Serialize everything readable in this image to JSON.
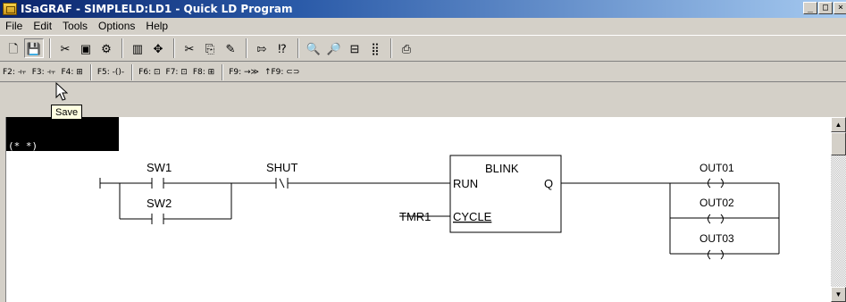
{
  "window": {
    "title": "ISaGRAF - SIMPLELD:LD1 - Quick LD Program",
    "controls": [
      "_",
      "□",
      "×"
    ]
  },
  "menu": [
    "File",
    "Edit",
    "Tools",
    "Options",
    "Help"
  ],
  "toolbar": {
    "icons": [
      {
        "name": "new-file-icon",
        "glyph": "🗋"
      },
      {
        "name": "save-icon",
        "glyph": "💾"
      },
      {
        "sep": true
      },
      {
        "name": "cut-tool-icon",
        "glyph": "✂"
      },
      {
        "name": "display-icon",
        "glyph": "▣"
      },
      {
        "name": "connect-icon",
        "glyph": "⚙"
      },
      {
        "sep": true
      },
      {
        "name": "book-icon",
        "glyph": "▥"
      },
      {
        "name": "move-icon",
        "glyph": "✥"
      },
      {
        "sep": true
      },
      {
        "name": "scissors-icon",
        "glyph": "✂"
      },
      {
        "name": "copy-icon",
        "glyph": "⎘"
      },
      {
        "name": "paste-icon",
        "glyph": "✎"
      },
      {
        "sep": true
      },
      {
        "name": "goto-icon",
        "glyph": "⇰"
      },
      {
        "name": "find-icon",
        "glyph": "⁉"
      },
      {
        "sep": true
      },
      {
        "name": "zoom-out-icon",
        "glyph": "🔍"
      },
      {
        "name": "zoom-in-icon",
        "glyph": "🔎"
      },
      {
        "name": "fit-icon",
        "glyph": "⊟"
      },
      {
        "name": "grid-icon",
        "glyph": "⣿"
      },
      {
        "sep": true
      },
      {
        "name": "print-icon",
        "glyph": "⎙"
      }
    ]
  },
  "function_keys": [
    {
      "label": "F2: ⫞⫟"
    },
    {
      "label": "F3: ⫞⫟"
    },
    {
      "label": "F4: ⊞"
    },
    {
      "sep": true
    },
    {
      "label": "F5: -()-"
    },
    {
      "sep": true
    },
    {
      "label": "F6: ⊡"
    },
    {
      "label": "F7: ⊡"
    },
    {
      "label": "F8: ⊞"
    },
    {
      "sep": true
    },
    {
      "label": "F9: →≫"
    },
    {
      "label": "↑F9: ⊂⊃"
    }
  ],
  "tooltip": "Save",
  "comment": "(* *)",
  "diagram": {
    "contacts": [
      "SW1",
      "SW2",
      "SHUT"
    ],
    "block": {
      "name": "BLINK",
      "input_run": "RUN",
      "input_cycle": "CYCLE",
      "output": "Q",
      "cycle_var": "TMR1"
    },
    "coils": [
      "OUT01",
      "OUT02",
      "OUT03"
    ]
  },
  "scrollbar": {
    "up": "▲",
    "down": "▼"
  }
}
